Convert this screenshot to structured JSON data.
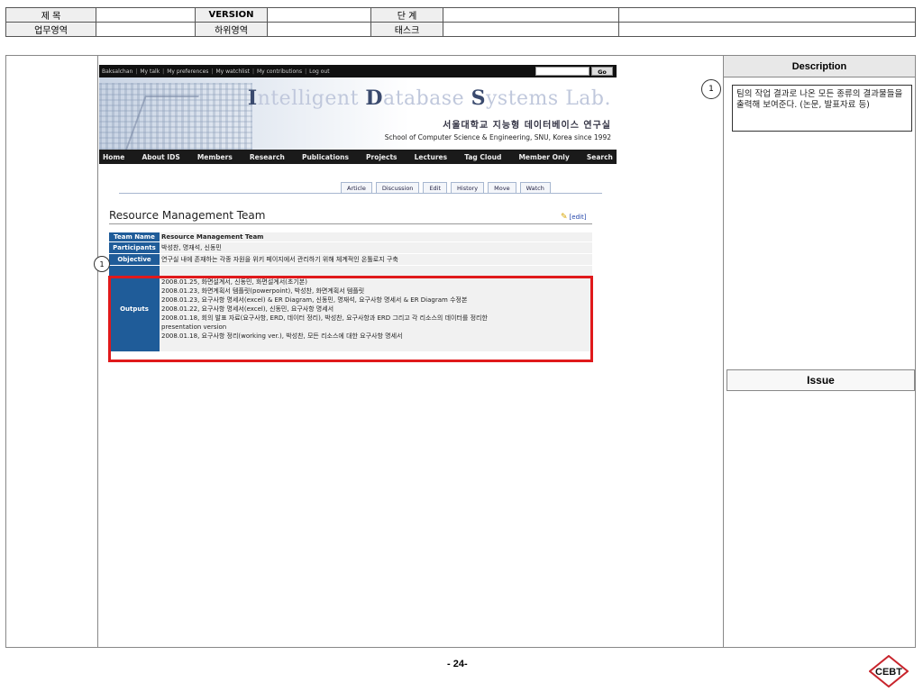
{
  "header": {
    "title_label": "제 목",
    "version_label": "VERSION",
    "stage_label": "단 계",
    "business_area_label": "업무영역",
    "sub_area_label": "하위영역",
    "task_label": "태스크"
  },
  "wiki": {
    "topbar": {
      "links": [
        "Baksalchan",
        "My talk",
        "My preferences",
        "My watchlist",
        "My contributions",
        "Log out"
      ],
      "go_label": "Go"
    },
    "banner": {
      "title_parts": [
        "I",
        "ntelligent ",
        "D",
        "atabase ",
        "S",
        "ystems Lab."
      ],
      "korean": "서울대학교 지능형 데이터베이스 연구실",
      "english": "School of Computer Science & Engineering, SNU, Korea since 1992"
    },
    "nav": [
      "Home",
      "About IDS",
      "Members",
      "Research",
      "Publications",
      "Projects",
      "Lectures",
      "Tag Cloud",
      "Member Only",
      "Search"
    ],
    "tabs": [
      "Article",
      "Discussion",
      "Edit",
      "History",
      "Move",
      "Watch"
    ],
    "heading": "Resource Management Team",
    "edit_link": "[edit]",
    "table": {
      "team_name_key": "Team Name",
      "team_name_val": "Resource Management Team",
      "participants_key": "Participants",
      "participants_val": "박성찬, 명재석, 신동민",
      "objective_key": "Objective",
      "objective_val": "연구실 내에 존재하는 각종 자원을 위키 페이지에서 관리하기 위해 체계적인 온톨로지 구축",
      "outputs_key": "Outputs",
      "outputs": [
        "2008.01.25, 화면설계서, 신동민, 화면설계서(초기본)",
        "2008.01.23, 화면계획서 템플릿(powerpoint), 박성찬, 화면계획서 템플릿",
        "2008.01.23, 요구사항 명세서(excel) & ER Diagram, 신동민, 명재석, 요구사항 명세서 & ER Diagram 수정본",
        "2008.01.22, 요구사항 명세서(excel), 신동민, 요구사항 명세서",
        "2008.01.18, 회의 발표 자료(요구사항, ERD, 데이터 정리), 박성찬, 요구사항과 ERD 그리고 각 리소스의 데이터를 정리한",
        "presentation version",
        "2008.01.18, 요구사항 정리(working ver.), 박성찬, 모든 리소스에 대한 요구사항 명세서"
      ]
    }
  },
  "annotations": {
    "marker_1": "1",
    "marker_1b": "1"
  },
  "description": {
    "header": "Description",
    "text": "팀의 작업 결과로 나온 모든 종류의 결과물들을 출력해 보여준다. (논문, 발표자료 등)"
  },
  "issue": {
    "header": "Issue"
  },
  "footer": {
    "page": "- 24-",
    "logo_text": "CEBT"
  },
  "colors": {
    "highlight": "#e0191b",
    "table_key_bg": "#1f5c99"
  }
}
